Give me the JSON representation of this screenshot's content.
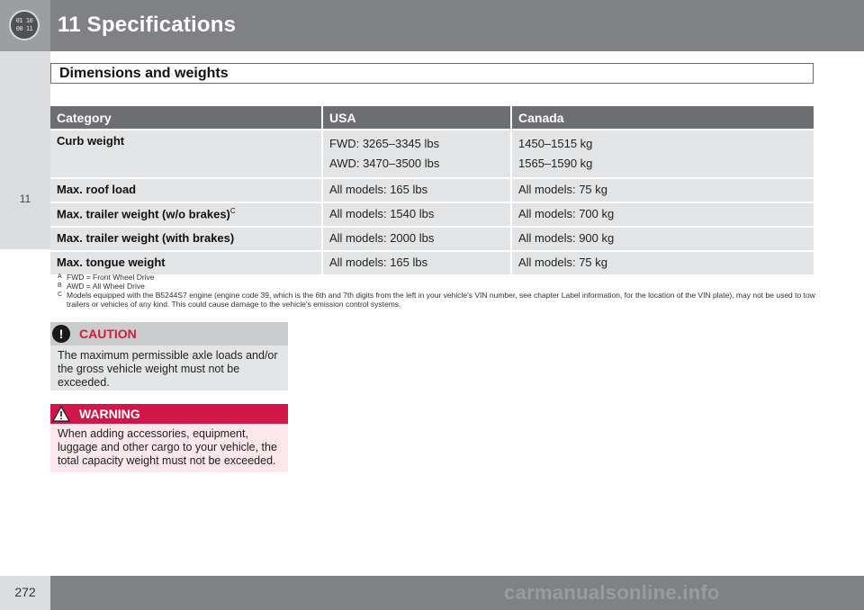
{
  "header": {
    "chapter_title": "11 Specifications",
    "chapter_icon_text": "01 10 00 11"
  },
  "sidebar": {
    "chapter_number": "11"
  },
  "section": {
    "title": "Dimensions and weights"
  },
  "table": {
    "headers": [
      "Category",
      "USA",
      "Canada"
    ],
    "rows": [
      {
        "category": "Curb weight",
        "usa": [
          "FWD: 3265–3345 lbs",
          "AWD: 3470–3500 lbs"
        ],
        "canada": [
          "1450–1515 kg",
          "1565–1590 kg"
        ]
      },
      {
        "category": "Max. roof load",
        "usa": [
          "All models: 165 lbs"
        ],
        "canada": [
          "All models: 75 kg"
        ]
      },
      {
        "category": "Max. trailer weight (w/o brakes)",
        "category_sup": "C",
        "usa": [
          "All models: 1540 lbs"
        ],
        "canada": [
          "All models: 700 kg"
        ]
      },
      {
        "category": "Max. trailer weight (with brakes)",
        "usa": [
          "All models: 2000 lbs"
        ],
        "canada": [
          "All models: 900 kg"
        ]
      },
      {
        "category": "Max. tongue weight",
        "usa": [
          "All models: 165 lbs"
        ],
        "canada": [
          "All models: 75 kg"
        ]
      }
    ]
  },
  "footnotes": [
    {
      "mark": "A",
      "text": "FWD = Front Wheel Drive"
    },
    {
      "mark": "B",
      "text": "AWD = All Wheel Drive"
    },
    {
      "mark": "C",
      "text": "Models equipped with the B5244S7 engine (engine code 39, which is the 6th and 7th digits from the left in your vehicle's VIN number, see chapter Label information, for the location of the VIN plate), may not be used to tow trailers or vehicles of any kind. This could cause damage to the vehicle's emission control systems."
    }
  ],
  "caution": {
    "title": "CAUTION",
    "icon": "exclamation-icon",
    "text": "The maximum permissible axle loads and/or the gross vehicle weight must not be exceeded."
  },
  "warning": {
    "title": "WARNING",
    "icon": "warning-triangle-icon",
    "text": "When adding accessories, equipment, luggage and other cargo to your vehicle, the total capacity weight must not be exceeded."
  },
  "footer": {
    "page_number": "272",
    "watermark": "carmanualsonline.info"
  },
  "colors": {
    "header_bar": "#808184",
    "table_header": "#6d6e71",
    "table_row": "#e3e4e5",
    "caution_accent": "#d11c3c",
    "warning_bar": "#d1174a",
    "warning_body": "#fbe7ec"
  }
}
